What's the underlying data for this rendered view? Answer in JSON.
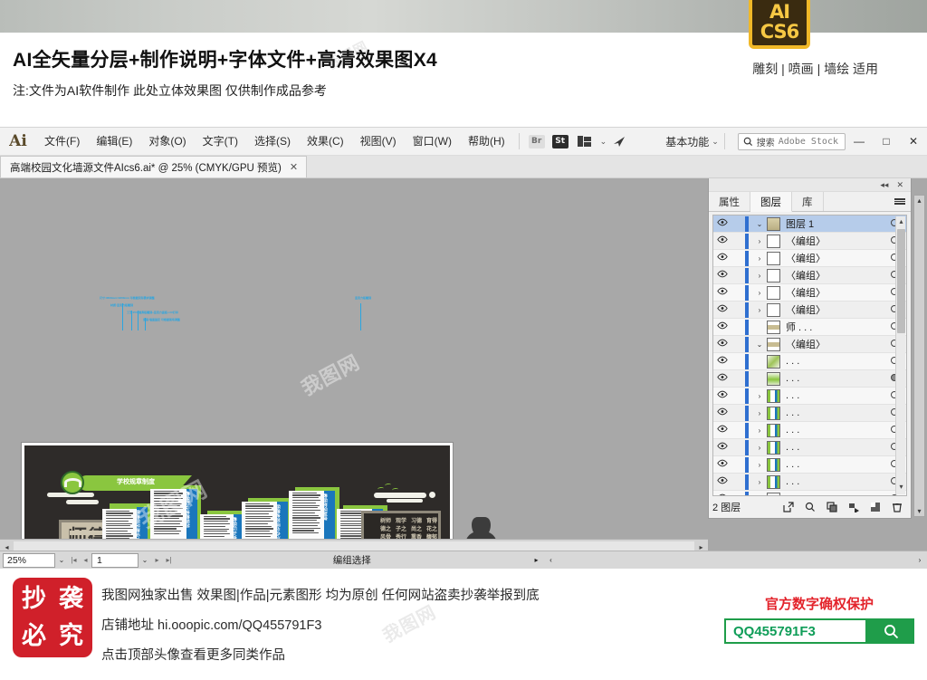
{
  "banner": {
    "title": "AI全矢量分层+制作说明+字体文件+高清效果图X4",
    "subtitle": "注:文件为AI软件制作 此处立体效果图 仅供制作成品参考",
    "tags": "雕刻 | 喷画 | 墙绘 适用",
    "badge_line1": "AI",
    "badge_line2": "CS6"
  },
  "app": {
    "logo": "Ai",
    "menus": [
      {
        "label": "文件(F)"
      },
      {
        "label": "编辑(E)"
      },
      {
        "label": "对象(O)"
      },
      {
        "label": "文字(T)"
      },
      {
        "label": "选择(S)"
      },
      {
        "label": "效果(C)"
      },
      {
        "label": "视图(V)"
      },
      {
        "label": "窗口(W)"
      },
      {
        "label": "帮助(H)"
      }
    ],
    "bridge_label": "Br",
    "stock_label": "St",
    "workspace_name": "基本功能",
    "search_cn": "搜索",
    "search_en": "Adobe Stock",
    "window_controls": {
      "minimize": "—",
      "maximize": "□",
      "close": "✕"
    },
    "tab": {
      "title": "高端校园文化墙源文件AIcs6.ai* @ 25% (CMYK/GPU 预览)",
      "close": "✕"
    }
  },
  "panel": {
    "collapse_icon": "◂◂",
    "close_icon": "✕",
    "tabs": [
      {
        "label": "属性",
        "active": false
      },
      {
        "label": "图层",
        "active": true
      },
      {
        "label": "库",
        "active": false
      }
    ],
    "layers": [
      {
        "name": "图层 1",
        "selected": true,
        "expanded": true,
        "twirl": "⌄",
        "thumb": "layer",
        "target_filled": false
      },
      {
        "name": "〈编组〉",
        "selected": false,
        "expanded": false,
        "twirl": "›",
        "thumb": "white",
        "target_filled": false
      },
      {
        "name": "〈编组〉",
        "selected": false,
        "expanded": false,
        "twirl": "›",
        "thumb": "white",
        "target_filled": false
      },
      {
        "name": "〈编组〉",
        "selected": false,
        "expanded": false,
        "twirl": "›",
        "thumb": "white",
        "target_filled": false
      },
      {
        "name": "〈编组〉",
        "selected": false,
        "expanded": false,
        "twirl": "›",
        "thumb": "white",
        "target_filled": false
      },
      {
        "name": "〈编组〉",
        "selected": false,
        "expanded": false,
        "twirl": "›",
        "thumb": "white",
        "target_filled": false
      },
      {
        "name": "师 . . .",
        "selected": false,
        "expanded": false,
        "twirl": "",
        "thumb": "text",
        "target_filled": false
      },
      {
        "name": "〈编组〉",
        "selected": false,
        "expanded": true,
        "twirl": "⌄",
        "thumb": "text",
        "target_filled": false
      },
      {
        "name": ". . .",
        "selected": false,
        "expanded": false,
        "twirl": "",
        "thumb": "art",
        "target_filled": false
      },
      {
        "name": ". . .",
        "selected": false,
        "expanded": false,
        "twirl": "",
        "thumb": "green",
        "target_filled": true
      },
      {
        "name": ". . .",
        "selected": false,
        "expanded": false,
        "twirl": "›",
        "thumb": "panel",
        "target_filled": false
      },
      {
        "name": ". . .",
        "selected": false,
        "expanded": false,
        "twirl": "›",
        "thumb": "panel",
        "target_filled": false
      },
      {
        "name": ". . .",
        "selected": false,
        "expanded": false,
        "twirl": "›",
        "thumb": "panel",
        "target_filled": false
      },
      {
        "name": ". . .",
        "selected": false,
        "expanded": false,
        "twirl": "›",
        "thumb": "panel",
        "target_filled": false
      },
      {
        "name": ". . .",
        "selected": false,
        "expanded": false,
        "twirl": "›",
        "thumb": "panel",
        "target_filled": false
      },
      {
        "name": ". . .",
        "selected": false,
        "expanded": false,
        "twirl": "›",
        "thumb": "panel",
        "target_filled": false
      },
      {
        "name": ". . .",
        "selected": false,
        "expanded": false,
        "twirl": "",
        "thumb": "cloud",
        "target_filled": false
      },
      {
        "name": ". . .",
        "selected": false,
        "expanded": false,
        "twirl": "",
        "thumb": "white",
        "target_filled": false
      }
    ],
    "footer": {
      "count_label": "2 图层",
      "icons": [
        "locate-object-icon",
        "search-icon",
        "new-sublayer-icon",
        "release-to-layers-icon",
        "new-layer-icon",
        "delete-layer-icon"
      ]
    }
  },
  "status": {
    "zoom": "25%",
    "page": "1",
    "tool": "编组选择"
  },
  "artwork": {
    "plaque_left_line1": "师德",
    "plaque_left_line2": "师风",
    "banner_text": "学校规章制度",
    "plaque_right_columns": [
      "育得花之馥郁",
      "习德尚之熏香",
      "观学子之秀行",
      "树师德之风骨"
    ]
  },
  "footer": {
    "stamp": [
      "抄",
      "袭",
      "必",
      "究"
    ],
    "lines": [
      "我图网独家出售 效果图|作品|元素图形 均为原创 任何网站盗卖抄袭举报到底",
      "店铺地址 hi.ooopic.com/QQ455791F3",
      "点击顶部头像查看更多同类作品"
    ],
    "right_title": "官方数字确权保护",
    "search_value": "QQ455791F3",
    "search_icon": "search-icon"
  },
  "watermark": "我图网"
}
